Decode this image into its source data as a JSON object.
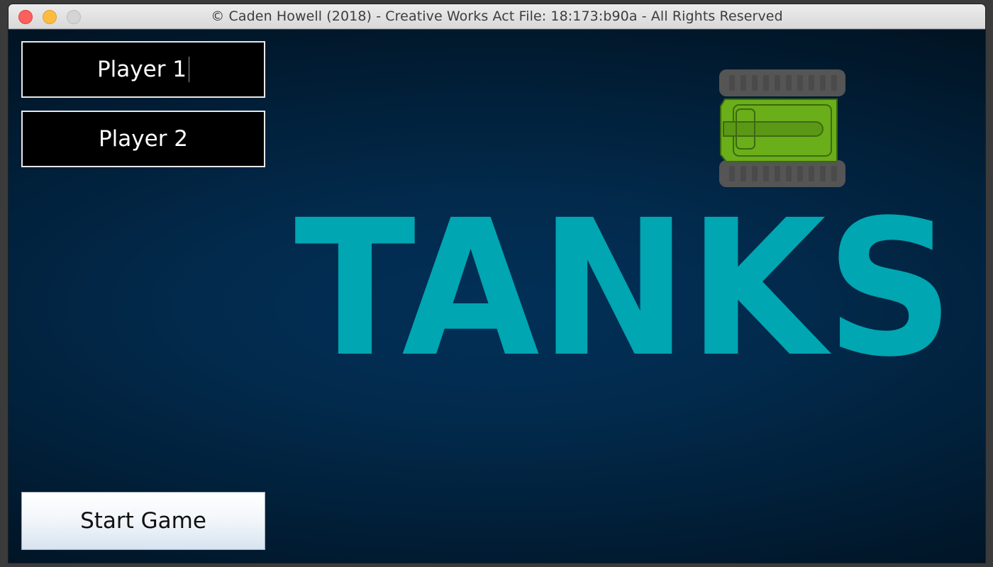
{
  "window": {
    "title": "© Caden Howell (2018) - Creative Works Act File: 18:173:b90a - All Rights Reserved"
  },
  "players": {
    "player1_value": "Player 1",
    "player2_value": "Player 2"
  },
  "actions": {
    "start_label": "Start Game"
  },
  "logo": {
    "text": "TANKS",
    "text_color": "#00a6b1",
    "tank_body_color": "#6aae1a",
    "tank_track_color": "#555555"
  }
}
